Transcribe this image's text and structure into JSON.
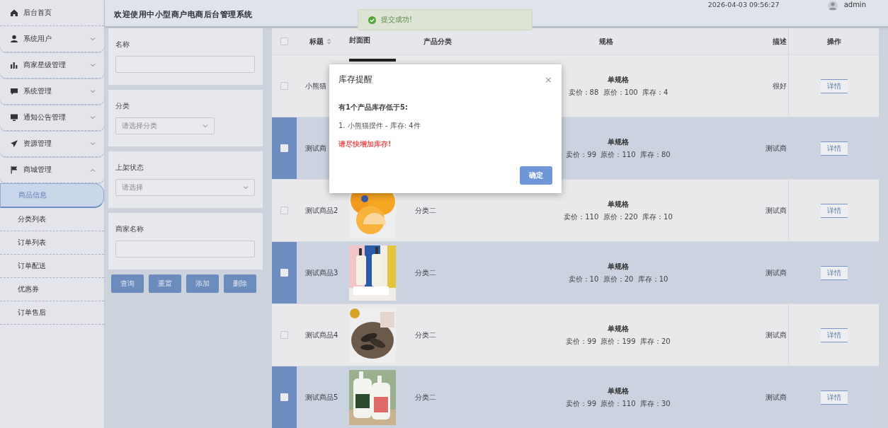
{
  "header": {
    "title": "欢迎使用中小型商户电商后台管理系统",
    "datetime": "2026-04-03 09:56:27",
    "user": "admin"
  },
  "toast": {
    "message": "提交成功!"
  },
  "sidebar": {
    "items": [
      {
        "label": "后台首页",
        "selected": false
      },
      {
        "label": "系统用户",
        "expanded": false,
        "selected": false
      },
      {
        "label": "商家星级管理",
        "expanded": false,
        "selected": false
      },
      {
        "label": "系统管理",
        "expanded": false,
        "selected": false
      },
      {
        "label": "通知公告管理",
        "expanded": false,
        "selected": false
      },
      {
        "label": "资源管理",
        "expanded": false,
        "selected": false
      },
      {
        "label": "商城管理",
        "expanded": true,
        "selected": false,
        "children": [
          {
            "label": "商品信息",
            "selected": true
          },
          {
            "label": "分类列表",
            "selected": false
          },
          {
            "label": "订单列表",
            "selected": false
          },
          {
            "label": "订单配送",
            "selected": false
          },
          {
            "label": "优惠券",
            "selected": false
          },
          {
            "label": "订单售后",
            "selected": false
          }
        ]
      }
    ]
  },
  "filters": [
    {
      "kind": "input",
      "label": "名称"
    },
    {
      "kind": "select",
      "label": "分类",
      "placeholder": "请选择分类"
    },
    {
      "kind": "select",
      "label": "上架状态",
      "placeholder": "请选择"
    },
    {
      "kind": "input",
      "label": "商家名称"
    }
  ],
  "filter_buttons": [
    "查询",
    "重置",
    "添加",
    "删除"
  ],
  "table": {
    "all_checked": false,
    "columns": [
      "标题",
      "封面图",
      "产品分类",
      "规格",
      "描述",
      "操作"
    ],
    "rows": [
      {
        "selected": false,
        "checked": false,
        "title": "小熊猫",
        "spec_title": "单规格",
        "spec": "卖价：88  原价：100  库存：4",
        "description": "很好",
        "action": "详情"
      },
      {
        "selected": true,
        "checked": false,
        "title": "测试商",
        "spec_title": "单规格",
        "spec": "卖价：99  原价：110  库存：80",
        "description": "测试商",
        "action": "详情"
      },
      {
        "selected": false,
        "checked": false,
        "title": "测试商品2",
        "category": "分类二",
        "spec_title": "单规格",
        "spec": "卖价：110  原价：220  库存：10",
        "description": "测试商",
        "action": "详情"
      },
      {
        "selected": true,
        "checked": false,
        "title": "测试商品3",
        "category": "分类二",
        "spec_title": "单规格",
        "spec": "卖价：10  原价：20  库存：10",
        "description": "测试商",
        "action": "详情"
      },
      {
        "selected": false,
        "checked": false,
        "title": "测试商品4",
        "category": "分类二",
        "spec_title": "单规格",
        "spec": "卖价：99  原价：199  库存：20",
        "description": "测试商",
        "action": "详情"
      },
      {
        "selected": true,
        "checked": false,
        "title": "测试商品5",
        "category": "分类二",
        "spec_title": "单规格",
        "spec": "卖价：99  原价：110  库存：30",
        "description": "测试商",
        "action": "详情"
      }
    ]
  },
  "dialog": {
    "title": "库存提醒",
    "close": "×",
    "summary": "有1个产品库存低于5:",
    "items": [
      "1. 小熊猫摆件 - 库存: 4件"
    ],
    "warning": "请尽快增加库存!",
    "confirm": "确定"
  }
}
